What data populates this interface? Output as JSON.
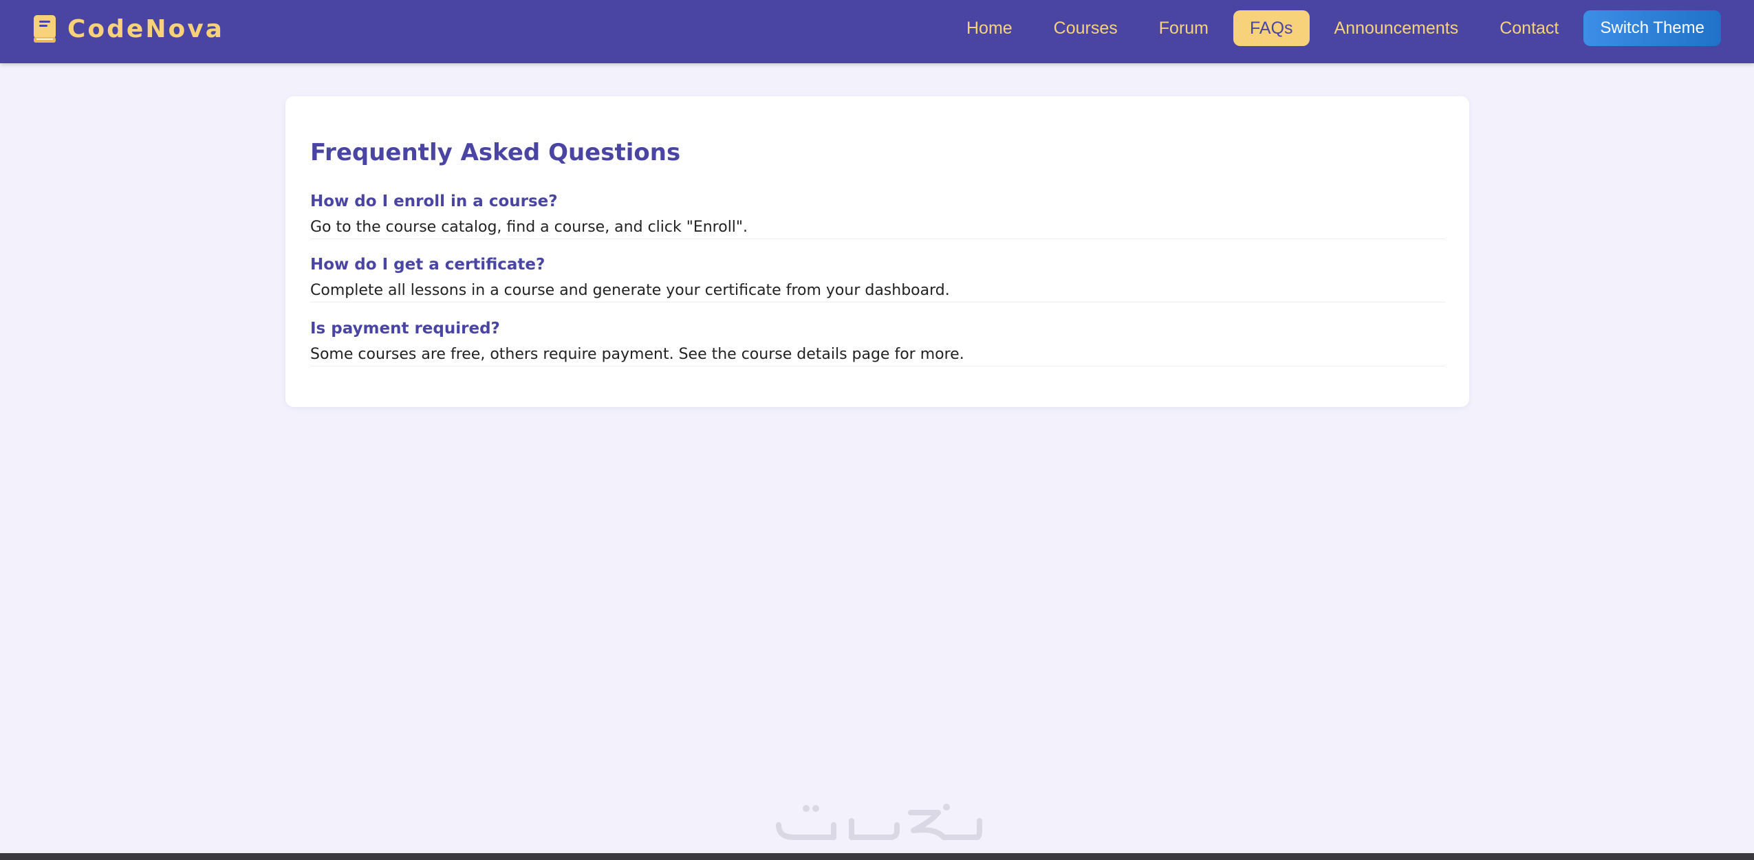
{
  "brand": {
    "icon": "book-icon",
    "name": "CodeNova"
  },
  "nav": {
    "items": [
      {
        "label": "Home",
        "active": false
      },
      {
        "label": "Courses",
        "active": false
      },
      {
        "label": "Forum",
        "active": false
      },
      {
        "label": "FAQs",
        "active": true
      },
      {
        "label": "Announcements",
        "active": false
      },
      {
        "label": "Contact",
        "active": false
      }
    ],
    "switch_theme_label": "Switch Theme"
  },
  "faq": {
    "title": "Frequently Asked Questions",
    "items": [
      {
        "question": "How do I enroll in a course?",
        "answer": "Go to the course catalog, find a course, and click \"Enroll\"."
      },
      {
        "question": "How do I get a certificate?",
        "answer": "Complete all lessons in a course and generate your certificate from your dashboard."
      },
      {
        "question": "Is payment required?",
        "answer": "Some courses are free, others require payment. See the course details page for more."
      }
    ]
  },
  "colors": {
    "nav_background": "#4a45a3",
    "accent_gold": "#f8d27a",
    "page_background": "#f3f2fc",
    "heading_purple": "#4a45a3",
    "switch_button_blue": "#2a7fd8"
  }
}
